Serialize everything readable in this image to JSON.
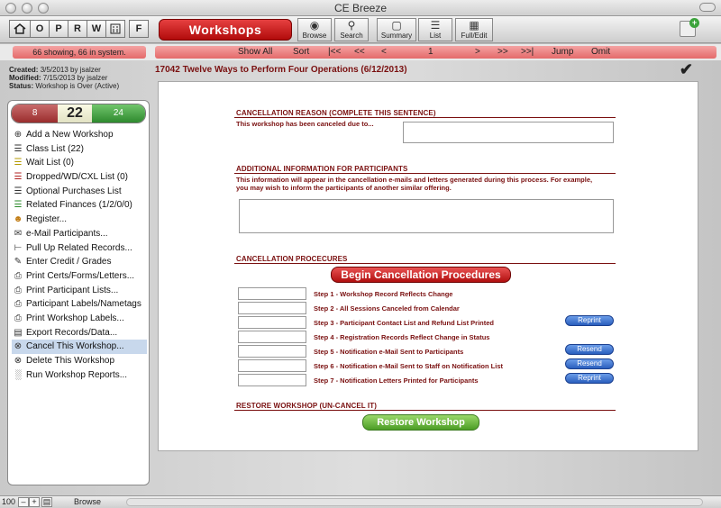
{
  "window": {
    "title": "CE Breeze"
  },
  "nav_buttons": [
    "O",
    "P",
    "R",
    "W",
    "F"
  ],
  "toolbar": {
    "module": "Workshops",
    "buttons": [
      {
        "label": "Browse",
        "icon": "eye-icon"
      },
      {
        "label": "Search",
        "icon": "magnifier-icon"
      },
      {
        "label": "Summary",
        "icon": "summary-icon"
      },
      {
        "label": "List",
        "icon": "list-icon"
      },
      {
        "label": "Full/Edit",
        "icon": "table-icon"
      }
    ]
  },
  "recordbar": {
    "counts": "66 showing, 66 in system.",
    "show_all": "Show All",
    "sort": "Sort",
    "first": "|<<",
    "prev_page": "<<",
    "prev": "<",
    "page": "1",
    "next": ">",
    "next_page": ">>",
    "last": ">>|",
    "jump": "Jump",
    "omit": "Omit"
  },
  "meta": {
    "created_label": "Created:",
    "created": "3/5/2013 by jsalzer",
    "modified_label": "Modified:",
    "modified": "7/15/2013 by jsalzer",
    "status_label": "Status:",
    "status": "Workshop is Over (Active)"
  },
  "stats": {
    "left": "8",
    "middle": "22",
    "right": "24"
  },
  "sidebar": {
    "items": [
      {
        "label": "Add a New Workshop",
        "icon": "plus-circle-icon"
      },
      {
        "label": "Class List (22)",
        "icon": "list-icon"
      },
      {
        "label": "Wait List (0)",
        "icon": "list-icon"
      },
      {
        "label": "Dropped/WD/CXL List (0)",
        "icon": "list-icon"
      },
      {
        "label": "Optional Purchases List",
        "icon": "list-icon"
      },
      {
        "label": "Related Finances (1/2/0/0)",
        "icon": "list-icon"
      },
      {
        "label": "Register...",
        "icon": "register-icon"
      },
      {
        "label": "e-Mail Participants...",
        "icon": "envelope-icon"
      },
      {
        "label": "Pull Up Related Records...",
        "icon": "tree-icon"
      },
      {
        "label": "Enter Credit / Grades",
        "icon": "pencil-icon"
      },
      {
        "label": "Print Certs/Forms/Letters...",
        "icon": "printer-icon"
      },
      {
        "label": "Print Participant Lists...",
        "icon": "printer-icon"
      },
      {
        "label": "Participant Labels/Nametags",
        "icon": "printer-icon"
      },
      {
        "label": "Print Workshop Labels...",
        "icon": "printer-icon"
      },
      {
        "label": "Export Records/Data...",
        "icon": "export-icon"
      },
      {
        "label": "Cancel This Workshop...",
        "icon": "x-circle-icon"
      },
      {
        "label": "Delete This Workshop",
        "icon": "x-circle-icon"
      },
      {
        "label": "Run Workshop Reports...",
        "icon": "bar-chart-icon"
      }
    ]
  },
  "record": {
    "title": "17042  Twelve Ways to Perform Four Operations  (6/12/2013)"
  },
  "form": {
    "reason_heading": "CANCELLATION REASON (COMPLETE THIS SENTENCE)",
    "reason_prompt": "This workshop has been canceled due to...",
    "reason_value": "",
    "info_heading": "ADDITIONAL INFORMATION FOR PARTICIPANTS",
    "info_text": "This information will appear in the cancellation e-mails and letters generated during this process.  For example, you may wish to inform the participants of another similar offering.",
    "info_value": "",
    "procedures_heading": "CANCELLATION PROCECURES",
    "begin_button": "Begin Cancellation Procedures",
    "steps": [
      {
        "label": "Step 1 - Workshop Record Reflects Change",
        "button": ""
      },
      {
        "label": "Step 2 - All Sessions Canceled from Calendar",
        "button": ""
      },
      {
        "label": "Step 3 - Participant Contact List and Refund List Printed",
        "button": "Reprint"
      },
      {
        "label": "Step 4 - Registration Records Reflect Change in Status",
        "button": ""
      },
      {
        "label": "Step 5 - Notification e-Mail Sent to Participants",
        "button": "Resend"
      },
      {
        "label": "Step 6 - Notification e-Mail Sent to Staff on Notification List",
        "button": "Resend"
      },
      {
        "label": "Step 7 - Notification Letters Printed for Participants",
        "button": "Reprint"
      }
    ],
    "restore_heading": "RESTORE WORKSHOP (UN-CANCEL IT)",
    "restore_button": "Restore Workshop"
  },
  "statusbar": {
    "zoom": "100",
    "mode": "Browse"
  }
}
